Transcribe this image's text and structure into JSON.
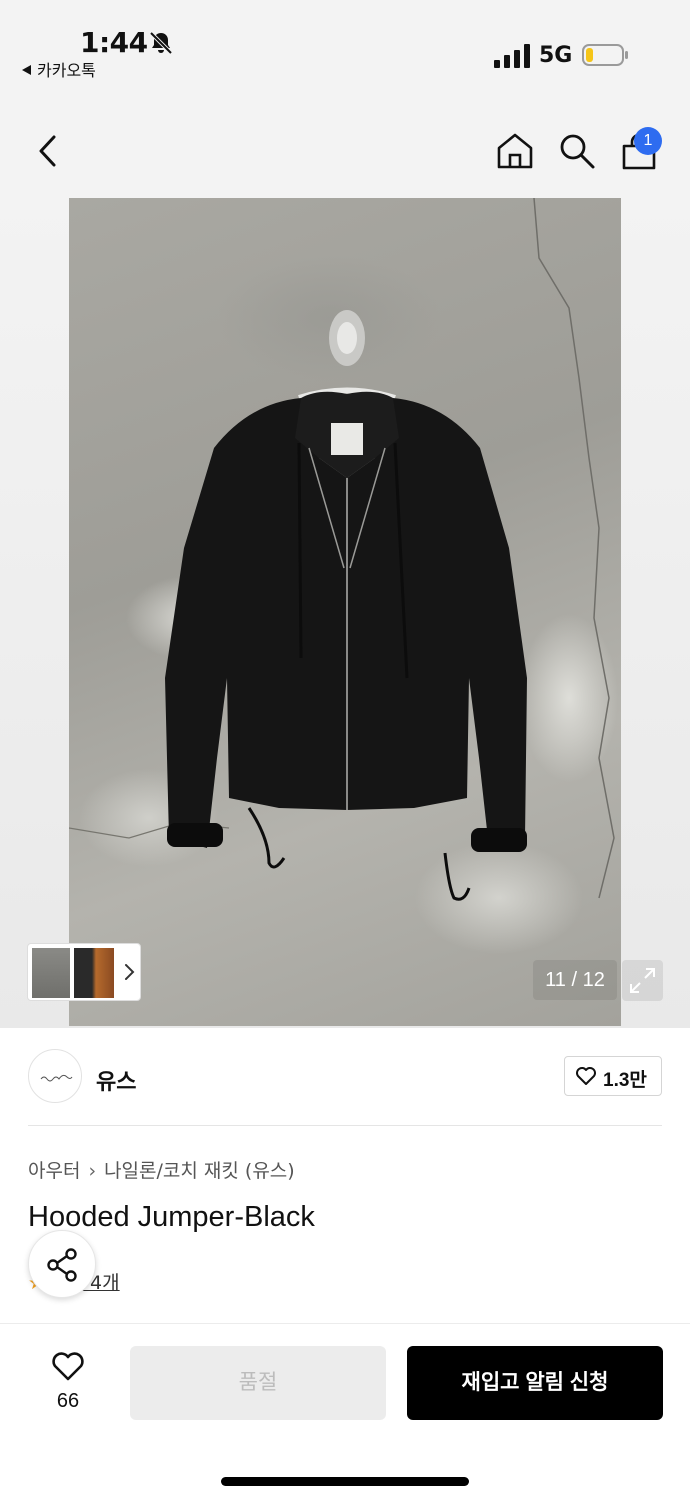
{
  "status_bar": {
    "time": "1:44",
    "back_app": "카카오톡",
    "network": "5G"
  },
  "nav": {
    "cart_badge": "1"
  },
  "gallery": {
    "counter": "11 / 12"
  },
  "brand": {
    "name": "유스",
    "like_count": "1.3만",
    "logo_text": "youth"
  },
  "product": {
    "category_parent": "아우터",
    "category_child": "나일론/코치 재킷 (유스)",
    "title": "Hooded Jumper-Black",
    "review_text": "후기 4개"
  },
  "bottom_bar": {
    "wish_count": "66",
    "soldout_label": "품절",
    "restock_label": "재입고 알림 신청"
  },
  "colors": {
    "accent_badge": "#2e6cf0",
    "primary_button": "#000000",
    "disabled_button": "#ececec"
  },
  "icons": [
    "bell-off-icon",
    "signal-icon",
    "battery-icon",
    "back-arrow-icon",
    "home-icon",
    "search-icon",
    "cart-icon",
    "chevron-right-icon",
    "expand-icon",
    "heart-icon",
    "share-icon",
    "star-icon"
  ]
}
